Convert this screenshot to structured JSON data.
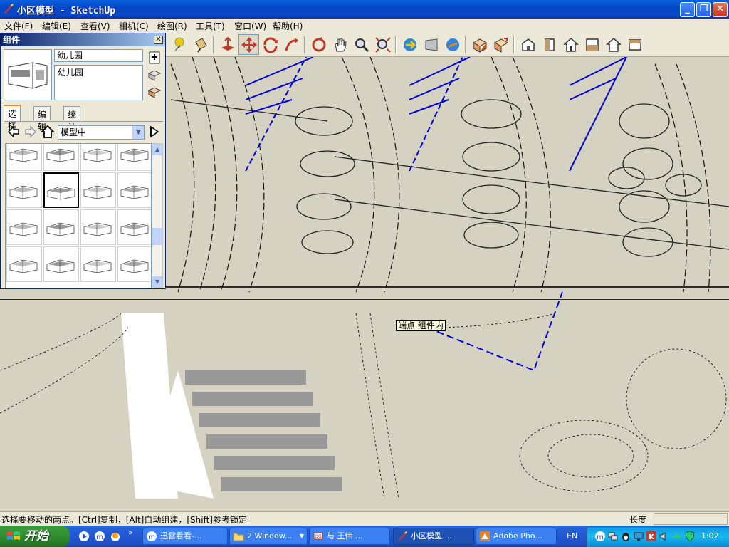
{
  "window": {
    "title": "小区模型 - SketchUp"
  },
  "menu": [
    {
      "label": "文件(F)"
    },
    {
      "label": "编辑(E)"
    },
    {
      "label": "查看(V)"
    },
    {
      "label": "相机(C)"
    },
    {
      "label": "绘图(R)"
    },
    {
      "label": "工具(T)"
    },
    {
      "label": "窗口(W)"
    },
    {
      "label": "帮助(H)"
    }
  ],
  "toolbar": {
    "icons": [
      "select-icon",
      "paint-bucket-icon",
      "push-pull-icon",
      "move-icon",
      "rotate-icon",
      "follow-me-icon",
      "orbit-icon",
      "pan-icon",
      "zoom-icon",
      "zoom-extents-icon",
      "get-models-icon",
      "share-model-icon",
      "google-earth-icon",
      "component-icon",
      "make-component-icon",
      "iso-view-icon",
      "top-view-icon",
      "front-view-icon",
      "right-view-icon",
      "back-view-icon",
      "left-view-icon"
    ],
    "pressed": "move-icon"
  },
  "components_panel": {
    "title": "组件",
    "name": "幼儿园",
    "description": "幼儿园",
    "tabs": [
      {
        "label": "选择",
        "active": true
      },
      {
        "label": "编辑",
        "active": false
      },
      {
        "label": "统计",
        "active": false
      }
    ],
    "collection": "模型中",
    "selected_index": 5,
    "thumbnails": 16
  },
  "viewport": {
    "tooltip": "端点 组件内",
    "background": "#d6d2c2"
  },
  "statusbar": {
    "message": "选择要移动的两点。[Ctrl]复制，[Alt]自动组建，[Shift]参考锁定",
    "length_label": "长度",
    "length_value": ""
  },
  "taskbar": {
    "start_label": "开始",
    "tasks": [
      {
        "label": "迅雷看看-...",
        "icon": "xunlei-icon",
        "active": false
      },
      {
        "label": "2 Window...",
        "icon": "folder-icon",
        "active": false
      },
      {
        "label": "与 王伟 ...",
        "icon": "chat-icon",
        "active": false
      },
      {
        "label": "小区模型 ...",
        "icon": "sketchup-icon",
        "active": true
      },
      {
        "label": "Adobe Pho...",
        "icon": "photoshop-icon",
        "active": false
      }
    ],
    "language": "EN",
    "clock": "1:02"
  }
}
